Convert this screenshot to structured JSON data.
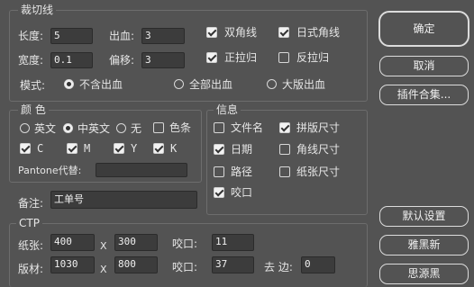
{
  "trim": {
    "title": "裁切线",
    "length_label": "长度:",
    "length_value": "5",
    "width_label": "宽度:",
    "width_value": "0.1",
    "bleed_label": "出血:",
    "bleed_value": "3",
    "offset_label": "偏移:",
    "offset_value": "3",
    "double_corner": "双角线",
    "japanese_corner": "日式角线",
    "positive_register": "正拉归",
    "reverse_register": "反拉归",
    "mode_label": "模式:",
    "mode_options": [
      "不含出血",
      "全部出血",
      "大版出血"
    ]
  },
  "color": {
    "title": "颜 色",
    "lang_options": [
      "英文",
      "中英文",
      "无"
    ],
    "color_bar_label": "色条",
    "cmyk": [
      "C",
      "M",
      "Y",
      "K"
    ],
    "pantone_label": "Pantone代替:",
    "pantone_value": ""
  },
  "info": {
    "title": "信息",
    "filename": "文件名",
    "imposition_size": "拼版尺寸",
    "date": "日期",
    "corner_size": "角线尺寸",
    "path": "路径",
    "paper_size": "纸张尺寸",
    "gripper": "咬口"
  },
  "note": {
    "label": "备注:",
    "value": "工单号"
  },
  "ctp": {
    "title": "CTP",
    "paper_label": "纸张:",
    "paper_w": "400",
    "x1": "X",
    "paper_h": "300",
    "gripper1_label": "咬口:",
    "gripper1_value": "11",
    "plate_label": "版材:",
    "plate_w": "1030",
    "x2": "X",
    "plate_h": "800",
    "gripper2_label": "咬口:",
    "gripper2_value": "37",
    "remove_edge_label": "去 边:",
    "remove_edge_value": "0"
  },
  "buttons": {
    "ok": "确定",
    "cancel": "取消",
    "plugins": "插件合集...",
    "defaults": "默认设置",
    "yaheixin": "雅黑新",
    "siyuanhei": "思源黑"
  }
}
